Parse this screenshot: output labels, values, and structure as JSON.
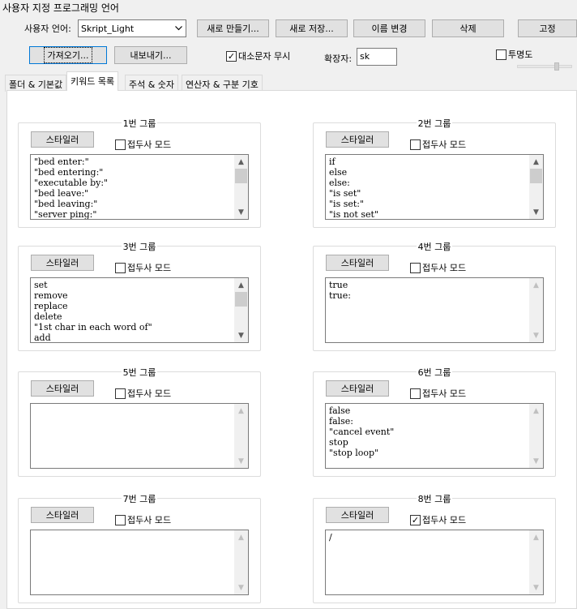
{
  "window": {
    "title": "사용자 지정 프로그래밍 언어"
  },
  "toolbar": {
    "language_label": "사용자 언어:",
    "language_value": "Skript_Light",
    "new_label": "새로 만들기...",
    "save_as_label": "새로 저장...",
    "rename_label": "이름 변경",
    "delete_label": "삭제",
    "dock_label": "고정",
    "import_label": "가져오기...",
    "export_label": "내보내기...",
    "ignore_case_label": "대소문자 무시",
    "ignore_case_checked": true,
    "ext_label": "확장자:",
    "ext_value": "sk",
    "transparency_label": "투명도",
    "transparency_checked": false
  },
  "tabs": [
    {
      "label": "폴더 & 기본값",
      "active": false
    },
    {
      "label": "키워드 목록",
      "active": true
    },
    {
      "label": "주석 & 숫자",
      "active": false
    },
    {
      "label": "연산자 & 구분 기호",
      "active": false
    }
  ],
  "groups": [
    {
      "title": "1번 그룹",
      "styler": "스타일러",
      "prefix_label": "접두사 모드",
      "prefix_checked": false,
      "scroll_enabled": true,
      "items": [
        "\"bed enter:\"",
        "\"bed entering:\"",
        "\"executable by:\"",
        "\"bed leave:\"",
        "\"bed leaving:\"",
        "\"server ping:\""
      ]
    },
    {
      "title": "2번 그룹",
      "styler": "스타일러",
      "prefix_label": "접두사 모드",
      "prefix_checked": false,
      "scroll_enabled": true,
      "items": [
        "if",
        "else",
        "else:",
        "\"is set\"",
        "\"is set:\"",
        "\"is not set\""
      ]
    },
    {
      "title": "3번 그룹",
      "styler": "스타일러",
      "prefix_label": "접두사 모드",
      "prefix_checked": false,
      "scroll_enabled": true,
      "items": [
        "set",
        "remove",
        "replace",
        "delete",
        "\"1st char in each word of\"",
        "add"
      ]
    },
    {
      "title": "4번 그룹",
      "styler": "스타일러",
      "prefix_label": "접두사 모드",
      "prefix_checked": false,
      "scroll_enabled": false,
      "items": [
        "true",
        "true:"
      ]
    },
    {
      "title": "5번 그룹",
      "styler": "스타일러",
      "prefix_label": "접두사 모드",
      "prefix_checked": false,
      "scroll_enabled": false,
      "items": []
    },
    {
      "title": "6번 그룹",
      "styler": "스타일러",
      "prefix_label": "접두사 모드",
      "prefix_checked": false,
      "scroll_enabled": false,
      "items": [
        "false",
        "false:",
        "\"cancel event\"",
        "stop",
        "\"stop loop\""
      ]
    },
    {
      "title": "7번 그룹",
      "styler": "스타일러",
      "prefix_label": "접두사 모드",
      "prefix_checked": false,
      "scroll_enabled": false,
      "items": []
    },
    {
      "title": "8번 그룹",
      "styler": "스타일러",
      "prefix_label": "접두사 모드",
      "prefix_checked": true,
      "scroll_enabled": false,
      "items": [
        "/"
      ]
    }
  ]
}
